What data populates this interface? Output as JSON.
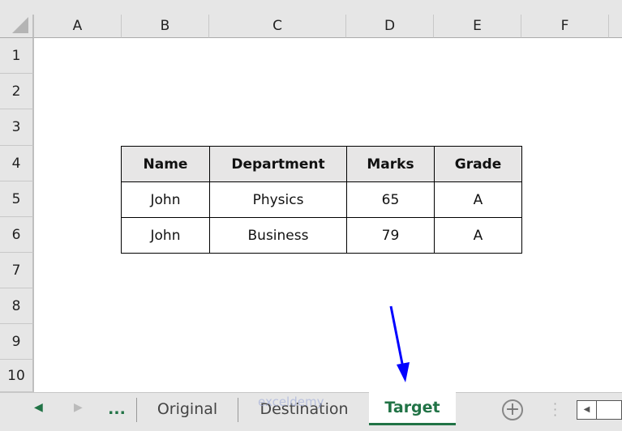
{
  "columns": [
    "A",
    "B",
    "C",
    "D",
    "E",
    "F"
  ],
  "rows": [
    "1",
    "2",
    "3",
    "4",
    "5",
    "6",
    "7",
    "8",
    "9",
    "10"
  ],
  "table": {
    "headers": [
      "Name",
      "Department",
      "Marks",
      "Grade"
    ],
    "rows": [
      [
        "John",
        "Physics",
        "65",
        "A"
      ],
      [
        "John",
        "Business",
        "79",
        "A"
      ]
    ]
  },
  "sheet_tabs": {
    "more_label": "...",
    "tabs": [
      {
        "label": "Original"
      },
      {
        "label": "Destination"
      },
      {
        "label": "Target",
        "active": true
      }
    ],
    "add_icon": "plus-circle-icon"
  },
  "watermark": "exceldemy",
  "colors": {
    "accent": "#217346",
    "arrow": "#0000ff",
    "header_fill": "#e7e6e6"
  }
}
